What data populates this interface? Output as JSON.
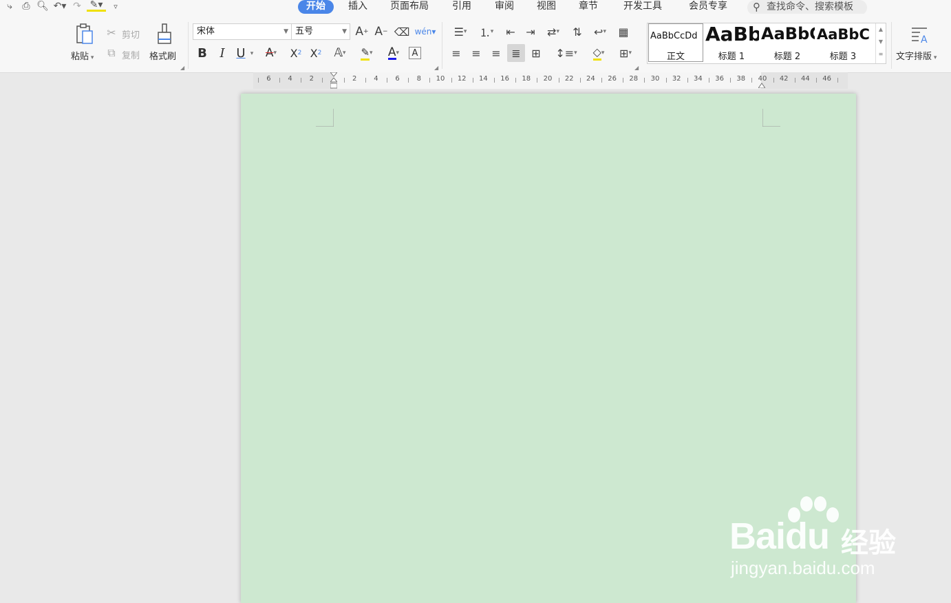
{
  "tabs": [
    "开始",
    "插入",
    "页面布局",
    "引用",
    "审阅",
    "视图",
    "章节",
    "开发工具",
    "会员专享"
  ],
  "active_tab": "开始",
  "search_placeholder": "查找命令、搜索模板",
  "clipboard": {
    "paste": "粘贴",
    "cut": "剪切",
    "copy": "复制",
    "format_painter": "格式刷"
  },
  "font": {
    "name": "宋体",
    "size": "五号"
  },
  "styles": [
    {
      "sample": "AaBbCcDd",
      "label": "正文"
    },
    {
      "sample": "AaBb",
      "label": "标题 1"
    },
    {
      "sample": "AaBbC",
      "label": "标题 2"
    },
    {
      "sample": "AaBbC",
      "label": "标题 3"
    }
  ],
  "text_layout": "文字排版",
  "ruler_labels": [
    "6",
    "4",
    "2",
    "2",
    "4",
    "6",
    "8",
    "10",
    "12",
    "14",
    "16",
    "18",
    "20",
    "22",
    "24",
    "26",
    "28",
    "30",
    "32",
    "34",
    "36",
    "38",
    "40",
    "42",
    "44",
    "46"
  ],
  "page_color": "#cde8d0",
  "accent_color": "#4a86e8",
  "watermark": {
    "brand": "Baidu",
    "product": "经验",
    "url": "jingyan.baidu.com"
  },
  "format_buttons": {
    "bold": "B",
    "italic": "I",
    "underline": "U"
  }
}
